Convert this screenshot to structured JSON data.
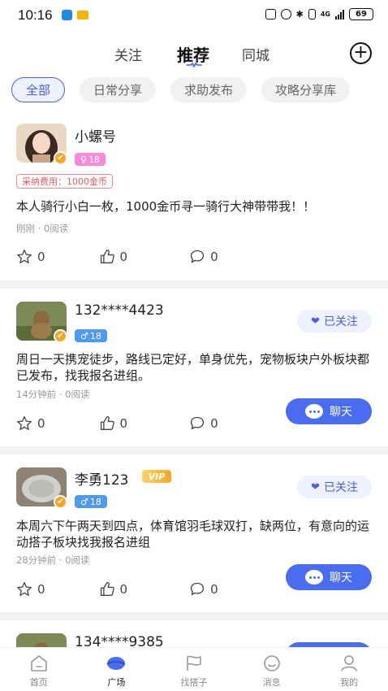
{
  "status_bar": {
    "time": "10:16",
    "network": "4G",
    "battery": "69"
  },
  "top_nav": {
    "tabs": [
      {
        "label": "关注"
      },
      {
        "label": "推荐"
      },
      {
        "label": "同城"
      }
    ],
    "active_tab": "推荐",
    "add_icon": "plus-circle-icon"
  },
  "filter_chips": [
    {
      "label": "全部",
      "active": true
    },
    {
      "label": "日常分享",
      "active": false
    },
    {
      "label": "求助发布",
      "active": false
    },
    {
      "label": "攻略分享库",
      "active": false
    }
  ],
  "posts": [
    {
      "username": "小螺号",
      "gender": "♀",
      "age": "18",
      "reward": "采纳费用：1000金币",
      "content": "本人骑行小白一枚，1000金币寻一骑行大神带带我！！",
      "meta": "刚刚 · 0阅读",
      "likes": "0",
      "thumbs": "0",
      "comments": "0"
    },
    {
      "username": "132****4423",
      "gender": "♂",
      "age": "18",
      "follow_label": "已关注",
      "content": "周日一天携宠徒步，路线已定好，单身优先，宠物板块户外板块都已发布，找我报名进组。",
      "meta": "14分钟前 · 0阅读",
      "likes": "0",
      "thumbs": "0",
      "comments": "0",
      "chat_label": "聊天"
    },
    {
      "username": "李勇123",
      "vip": "VIP",
      "gender": "♂",
      "age": "18",
      "follow_label": "已关注",
      "content": "本周六下午两天到四点，体育馆羽毛球双打，缺两位，有意向的运动搭子板块找我报名进组",
      "meta": "28分钟前 · 0阅读",
      "likes": "0",
      "thumbs": "0",
      "comments": "0",
      "chat_label": "聊天"
    },
    {
      "username": "134****9385"
    }
  ],
  "bottom_nav": [
    {
      "label": "首页",
      "icon": "home-icon"
    },
    {
      "label": "广场",
      "icon": "plaza-icon",
      "active": true
    },
    {
      "label": "找搭子",
      "icon": "flag-icon"
    },
    {
      "label": "消息",
      "icon": "message-icon"
    },
    {
      "label": "我的",
      "icon": "profile-icon"
    }
  ],
  "colors": {
    "accent": "#4a6cf0",
    "chip_active": "#4a5ee0",
    "vip_gold": "#f6a623",
    "female": "#f58bd8",
    "male": "#4e9af1"
  }
}
